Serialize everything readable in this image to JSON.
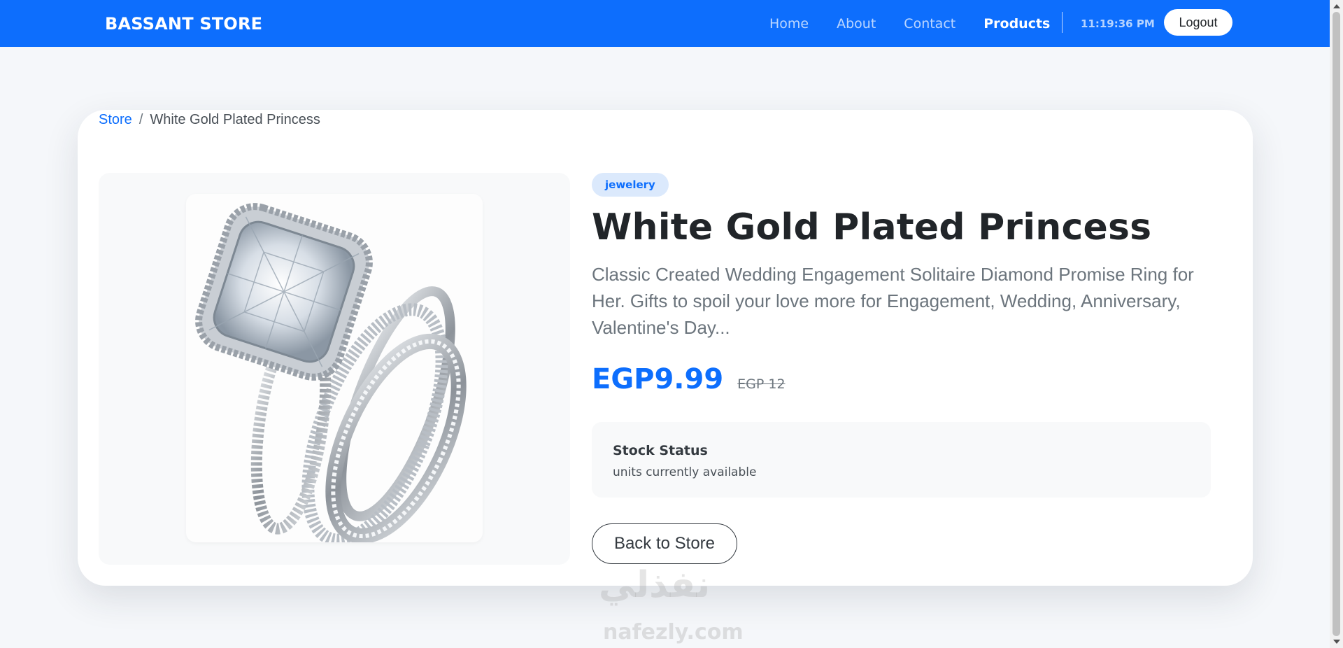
{
  "navbar": {
    "brand": "BASSANT STORE",
    "links": [
      {
        "label": "Home",
        "active": false
      },
      {
        "label": "About",
        "active": false
      },
      {
        "label": "Contact",
        "active": false
      },
      {
        "label": "Products",
        "active": true
      }
    ],
    "clock": "11:19:36 PM",
    "logout_label": "Logout",
    "accent_color": "#0d6efd"
  },
  "breadcrumb": {
    "store_label": "Store",
    "separator": "/",
    "current": "White Gold Plated Princess"
  },
  "product": {
    "category": "jewelery",
    "title": "White Gold Plated Princess",
    "description": "Classic Created Wedding Engagement Solitaire Diamond Promise Ring for Her. Gifts to spoil your love more for Engagement, Wedding, Anniversary, Valentine's Day...",
    "price": "EGP9.99",
    "old_price": "EGP 12",
    "image_icon": "ring-image",
    "stock": {
      "title": "Stock Status",
      "text": "units currently available"
    },
    "back_label": "Back to Store"
  },
  "watermark": {
    "logo": "نفذلي",
    "text": "nafezly.com"
  }
}
